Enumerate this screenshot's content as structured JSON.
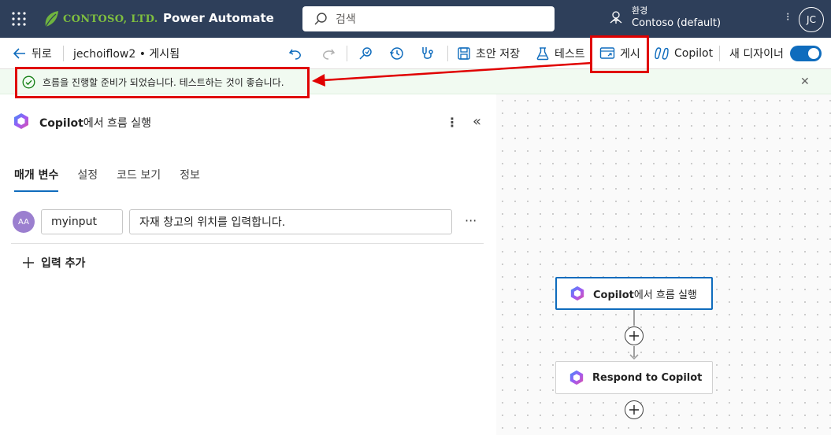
{
  "header": {
    "logo_text": "CONTOSO, LTD.",
    "app_name": "Power Automate",
    "search_placeholder": "검색",
    "env_label": "환경",
    "env_name": "Contoso (default)",
    "avatar_initials": "JC"
  },
  "cmdbar": {
    "back_label": "뒤로",
    "flow_status": "jechoiflow2 • 게시됨",
    "save_draft_label": "초안 저장",
    "test_label": "테스트",
    "publish_label": "게시",
    "copilot_label": "Copilot",
    "new_designer_label": "새 디자이너",
    "new_designer_on": true
  },
  "message": {
    "text": "흐름을 진행할 준비가 되었습니다. 테스트하는 것이 좋습니다."
  },
  "panel": {
    "title_bold": "Copilot",
    "title_rest": "에서 흐름 실행",
    "tabs": [
      {
        "label": "매개 변수",
        "active": true
      },
      {
        "label": "설정",
        "active": false
      },
      {
        "label": "코드 보기",
        "active": false
      },
      {
        "label": "정보",
        "active": false
      }
    ],
    "param": {
      "type_icon_text": "AA",
      "name": "myinput",
      "description": "자재 창고의 위치를 입력합니다."
    },
    "add_input_label": "입력 추가"
  },
  "canvas": {
    "nodes": [
      {
        "title_bold": "Copilot",
        "title_rest": "에서 흐름 실행",
        "selected": true
      },
      {
        "title_bold": "Respond to Copilot",
        "title_rest": "",
        "selected": false
      }
    ]
  },
  "colors": {
    "header_bg": "#2e3f5a",
    "accent": "#0f6cbd",
    "highlight": "#e00000",
    "success_bg": "#f1faf1"
  }
}
